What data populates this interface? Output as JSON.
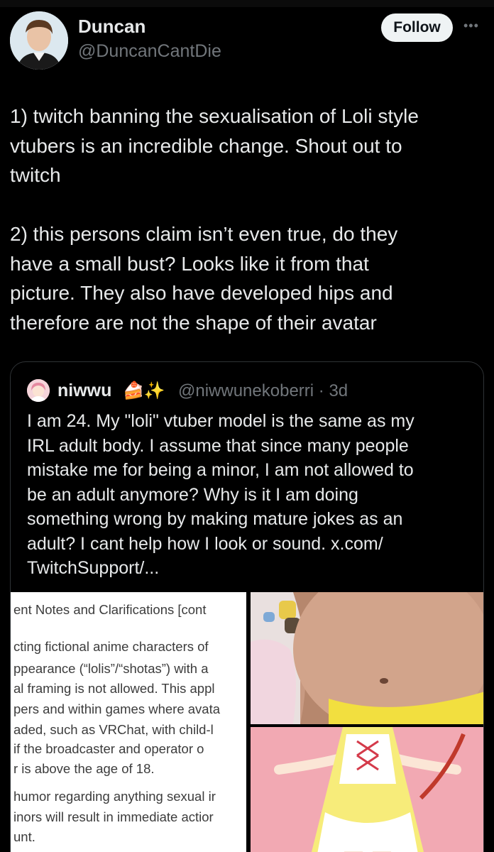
{
  "author": {
    "display_name": "Duncan",
    "handle": "@DuncanCantDie",
    "follow_label": "Follow",
    "more_icon": "•••"
  },
  "post": {
    "text": "1) twitch banning the sexualisation of Loli style\nvtubers is an incredible change. Shout out to\ntwitch\n\n2) this persons claim isn’t even true, do they\nhave a small bust? Looks like it from that\npicture. They also have developed hips and\ntherefore are not the shape of their avatar"
  },
  "quoted": {
    "name": "niwwu",
    "emoji": "🍰✨",
    "handle_time": "@niwwunekoberri · 3d",
    "text": "I am 24. My \"loli\" vtuber model is the same as my\nIRL adult body. I assume that since many people\nmistake me for being a minor, I am not allowed to\nbe an adult anymore? Why is it I am doing\nsomething wrong by making mature jokes as an\nadult? I cant help how I look or sound. x.com/\nTwitchSupport/...",
    "media": {
      "doc_lines": [
        "ent Notes and Clarifications [cont",
        "cting fictional anime characters of",
        "ppearance (“lolis”/“shotas”) with a",
        "al framing is not allowed. This appl",
        "pers and within games where avata",
        "aded, such as VRChat, with child-l",
        " if the broadcaster and operator o",
        "r is above the age of 18.",
        "humor regarding anything sexual ir",
        "inors will result in immediate actior",
        "unt."
      ]
    }
  },
  "colors": {
    "background": "#000000",
    "text": "#e7e9ea",
    "secondary": "#71767b",
    "border": "#2f3336",
    "follow_bg": "#eff3f4"
  }
}
